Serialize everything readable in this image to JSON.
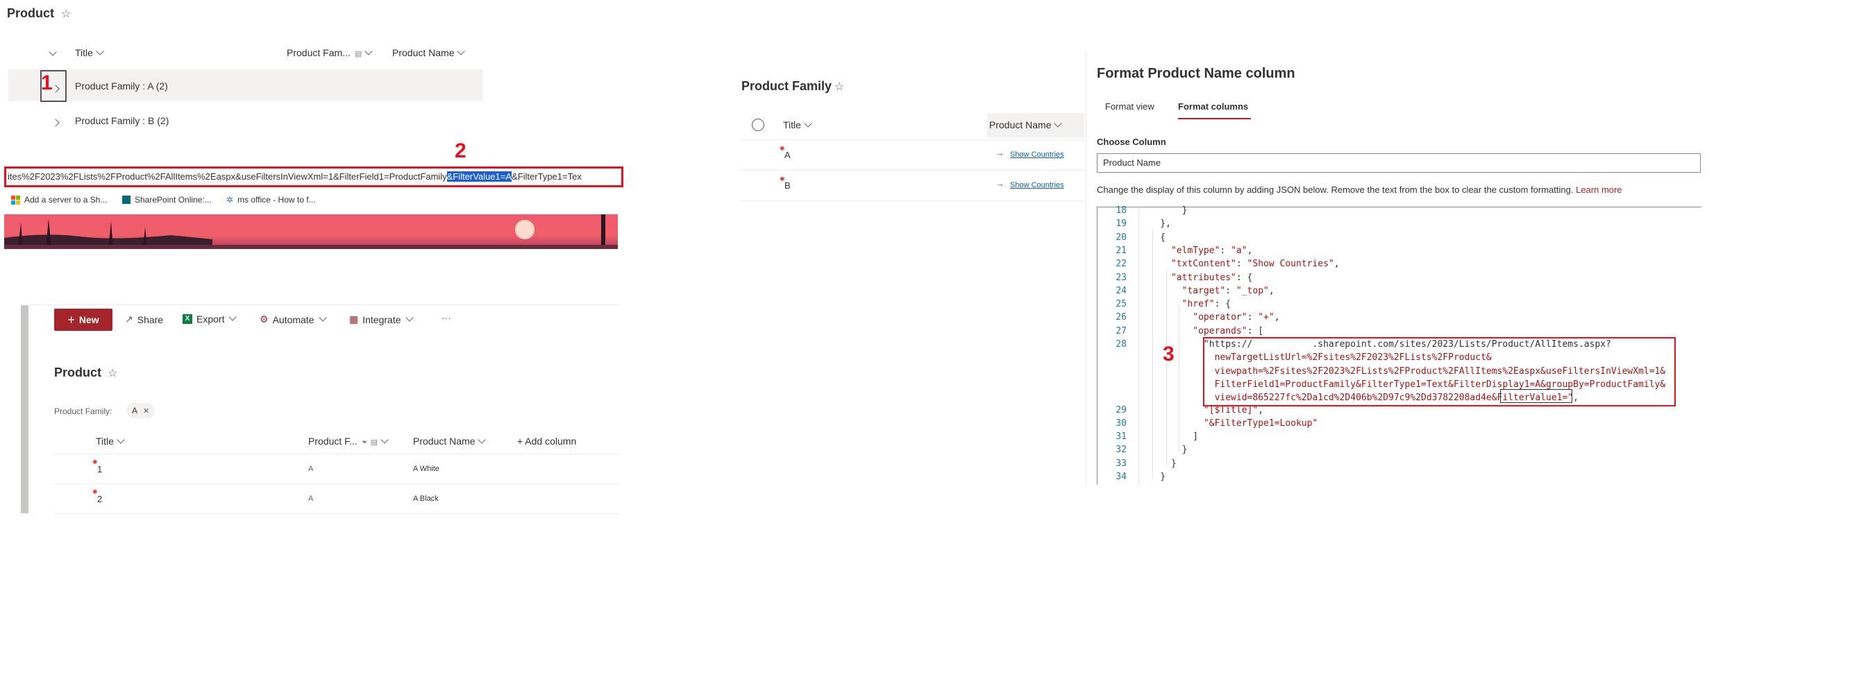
{
  "top_list": {
    "title": "Product",
    "columns": [
      "Title",
      "Product Fam...",
      "Product Name"
    ],
    "groups": [
      "Product Family : A (2)",
      "Product Family : B (2)"
    ]
  },
  "annotations": {
    "n1": "1",
    "n2": "2",
    "n3": "3"
  },
  "url_bar": {
    "text_before": "ites%2F2023%2FLists%2FProduct%2FAllItems%2Easpx&useFiltersInViewXml=1&FilterField1=ProductFamily",
    "text_selected": "&FilterValue1=A",
    "text_after": "&FilterType1=Tex"
  },
  "bookmarks": [
    "Add a server to a Sh...",
    "SharePoint Online:...",
    "ms office - How to f..."
  ],
  "commandbar": {
    "new": "New",
    "share": "Share",
    "export": "Export",
    "automate": "Automate",
    "integrate": "Integrate",
    "more": "···"
  },
  "bottom_list": {
    "title": "Product",
    "filter_label": "Product Family:",
    "filter_value": "A",
    "columns": [
      "Title",
      "Product F...",
      "Product Name",
      "+ Add column"
    ],
    "rows": [
      {
        "title": "1",
        "family": "A",
        "name": "A White"
      },
      {
        "title": "2",
        "family": "A",
        "name": "A Black"
      }
    ]
  },
  "family_list": {
    "title": "Product Family",
    "columns": [
      "Title",
      "Product Name"
    ],
    "rows": [
      {
        "title": "A",
        "link": "Show Countries"
      },
      {
        "title": "B",
        "link": "Show Countries"
      }
    ]
  },
  "format_panel": {
    "title": "Format Product Name column",
    "tabs": [
      "Format view",
      "Format columns"
    ],
    "choose_label": "Choose Column",
    "choose_value": "Product Name",
    "description": "Change the display of this column by adding JSON below. Remove the text from the box to clear the custom formatting.",
    "learn_more": "Learn more"
  },
  "code_lines": [
    {
      "n": "18",
      "t": "        }"
    },
    {
      "n": "19",
      "t": "    },"
    },
    {
      "n": "20",
      "t": "    {"
    },
    {
      "n": "21",
      "t": "      \"elmType\": \"a\","
    },
    {
      "n": "22",
      "t": "      \"txtContent\": \"Show Countries\","
    },
    {
      "n": "23",
      "t": "      \"attributes\": {"
    },
    {
      "n": "24",
      "t": "        \"target\": \"_top\","
    },
    {
      "n": "25",
      "t": "        \"href\": {"
    },
    {
      "n": "26",
      "t": "          \"operator\": \"+\","
    },
    {
      "n": "27",
      "t": "          \"operands\": ["
    },
    {
      "n": "28",
      "t": "            \"https://           .sharepoint.com/sites/2023/Lists/Product/AllItems.aspx?"
    }
  ],
  "code_wrap": [
    "              newTargetListUrl=%2Fsites%2F2023%2FLists%2FProduct&",
    "              viewpath=%2Fsites%2F2023%2FLists%2FProduct%2FAllItems%2Easpx&useFiltersInViewXml=1&",
    "              FilterField1=ProductFamily&FilterType1=Text&FilterDisplay1=A&groupBy=ProductFamily&",
    "              viewid=865227fc%2Da1cd%2D406b%2D97c9%2Dd3782208ad4e&"
  ],
  "code_wrap_tail": "FilterValue1=",
  "code_wrap_end": "\",",
  "code_after": [
    {
      "n": "29",
      "t": "            \"[$Title]\","
    },
    {
      "n": "30",
      "t": "            \"&FilterType1=Lookup\""
    },
    {
      "n": "31",
      "t": "          ]"
    },
    {
      "n": "32",
      "t": "        }"
    },
    {
      "n": "33",
      "t": "      }"
    },
    {
      "n": "34",
      "t": "    }"
    }
  ]
}
